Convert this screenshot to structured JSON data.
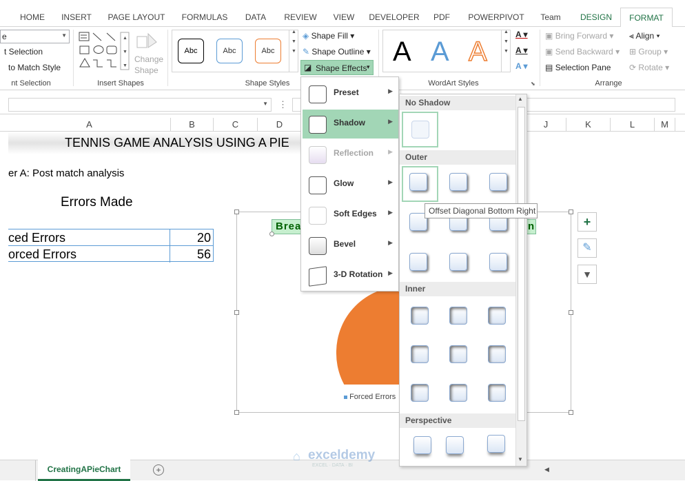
{
  "tabs": [
    "HOME",
    "INSERT",
    "PAGE LAYOUT",
    "FORMULAS",
    "DATA",
    "REVIEW",
    "VIEW",
    "DEVELOPER",
    "PDF",
    "POWERPIVOT",
    "Team",
    "DESIGN",
    "FORMAT"
  ],
  "ribbon": {
    "sel_left": {
      "line1": "t Selection",
      "line2": "to Match Style",
      "group": "nt Selection"
    },
    "insert_shapes": {
      "change_shape_1": "Change",
      "change_shape_2": "Shape",
      "group": "Insert Shapes"
    },
    "shape_styles": {
      "abc": "Abc",
      "fill": "Shape Fill",
      "outline": "Shape Outline",
      "effects": "Shape Effects",
      "group": "Shape Styles"
    },
    "wordart": {
      "letter": "A",
      "group": "WordArt Styles"
    },
    "arrange": {
      "bring_forward": "Bring Forward",
      "send_backward": "Send Backward",
      "selection_pane": "Selection Pane",
      "align": "Align",
      "group_btn": "Group",
      "rotate": "Rotate",
      "group": "Arrange"
    }
  },
  "columns": [
    "A",
    "B",
    "C",
    "D",
    "J",
    "K",
    "L",
    "M"
  ],
  "sheet": {
    "title": "TENNIS GAME ANALYSIS USING A PIE",
    "subtitle": "er A: Post match analysis",
    "errors_heading": "Errors Made",
    "rows": [
      {
        "label": "ced Errors",
        "value": "20"
      },
      {
        "label": "orced Errors",
        "value": "56"
      }
    ]
  },
  "chart": {
    "label_left": "Brea",
    "label_right": "n",
    "legend": "Forced Errors",
    "slice_color": "#ed7d31"
  },
  "menu": {
    "items": [
      {
        "label": "Preset",
        "enabled": true
      },
      {
        "label": "Shadow",
        "enabled": true,
        "selected": true
      },
      {
        "label": "Reflection",
        "enabled": false
      },
      {
        "label": "Glow",
        "enabled": true
      },
      {
        "label": "Soft Edges",
        "enabled": true
      },
      {
        "label": "Bevel",
        "enabled": true
      },
      {
        "label": "3-D Rotation",
        "enabled": true
      }
    ]
  },
  "gallery": {
    "no_shadow": "No Shadow",
    "outer": "Outer",
    "inner": "Inner",
    "perspective": "Perspective"
  },
  "tooltip": "Offset Diagonal Bottom Right",
  "sheet_tab": "CreatingAPieChart",
  "watermark": {
    "name": "exceldemy",
    "tagline": "EXCEL · DATA · BI"
  },
  "colors": {
    "accent": "#217346",
    "highlight": "#a2d6b6",
    "label_bg": "#c6efce",
    "label_text": "#006100"
  }
}
